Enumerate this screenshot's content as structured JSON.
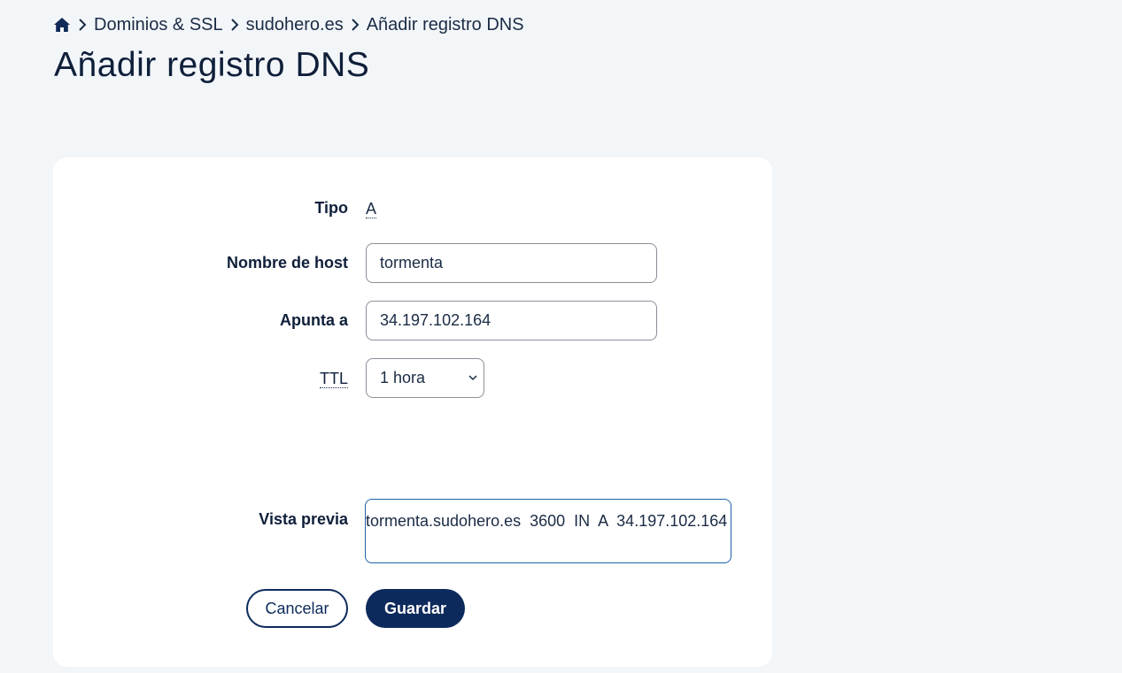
{
  "breadcrumb": {
    "items": [
      "Dominios & SSL",
      "sudohero.es",
      "Añadir registro DNS"
    ]
  },
  "page": {
    "title": "Añadir registro DNS"
  },
  "form": {
    "tipo": {
      "label": "Tipo",
      "value": "A"
    },
    "host": {
      "label": "Nombre de host",
      "value": "tormenta"
    },
    "target": {
      "label": "Apunta a",
      "value": "34.197.102.164"
    },
    "ttl": {
      "label": "TTL",
      "selected": "1 hora"
    },
    "preview": {
      "label": "Vista previa",
      "value": "tormenta.sudohero.es  3600  IN  A  34.197.102.164"
    }
  },
  "actions": {
    "cancel_label": "Cancelar",
    "save_label": "Guardar"
  },
  "icons": {
    "home": "home-icon",
    "separator": "chevron-right-icon",
    "select": "chevron-down-icon"
  },
  "colors": {
    "background": "#f3f6f9",
    "primary": "#0d2a5c",
    "text": "#1a2b45",
    "preview_border": "#1e62a8"
  }
}
